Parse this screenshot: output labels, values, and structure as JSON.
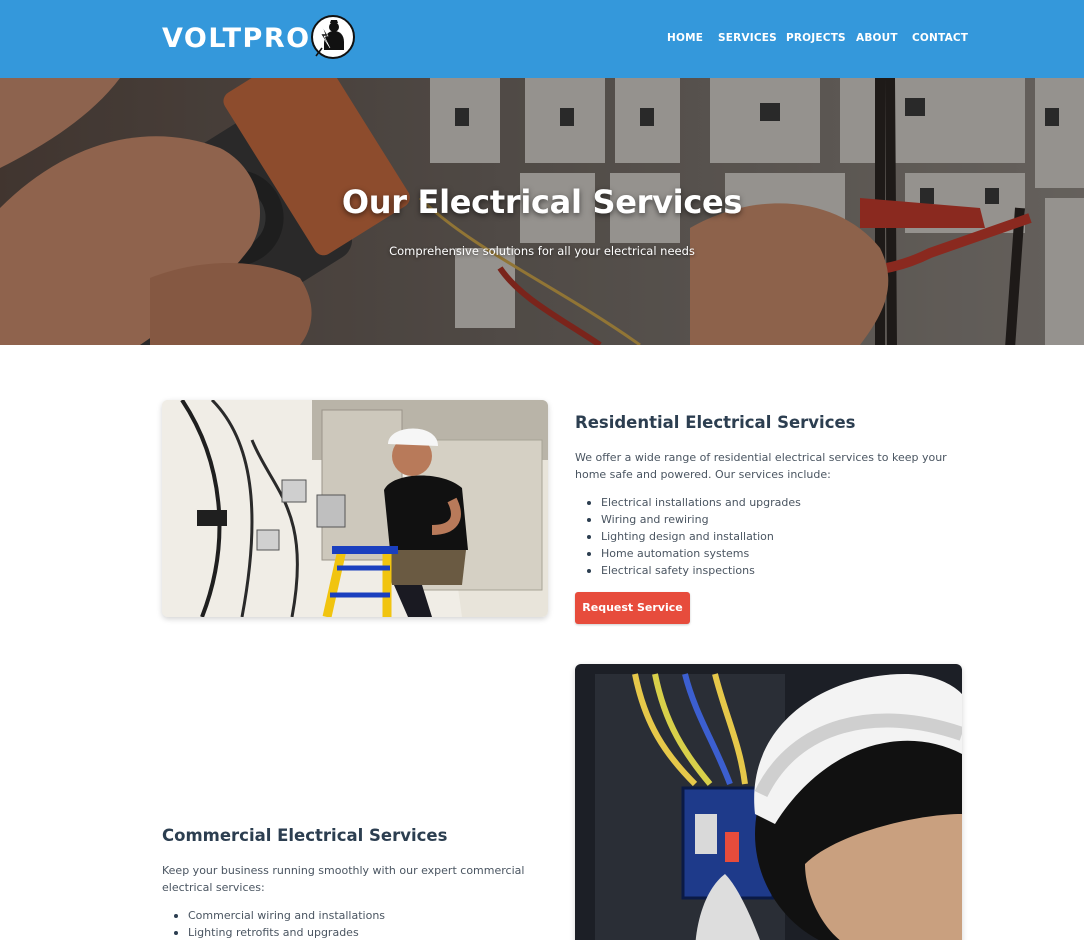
{
  "header": {
    "brand": "VOLTPRO",
    "nav": [
      "HOME",
      "SERVICES",
      "PROJECTS",
      "ABOUT",
      "CONTACT"
    ]
  },
  "hero": {
    "title": "Our Electrical Services",
    "subtitle": "Comprehensive solutions for all your electrical needs"
  },
  "residential": {
    "title": "Residential Electrical Services",
    "intro": "We offer a wide range of residential electrical services to keep your home safe and powered. Our services include:",
    "items": [
      "Electrical installations and upgrades",
      "Wiring and rewiring",
      "Lighting design and installation",
      "Home automation systems",
      "Electrical safety inspections"
    ],
    "button": "Request Service"
  },
  "commercial": {
    "title": "Commercial Electrical Services",
    "intro": "Keep your business running smoothly with our expert commercial electrical services:",
    "items": [
      "Commercial wiring and installations",
      "Lighting retrofits and upgrades"
    ]
  },
  "colors": {
    "header": "#3498db",
    "accent": "#e74c3c",
    "heading": "#2c3e50"
  }
}
